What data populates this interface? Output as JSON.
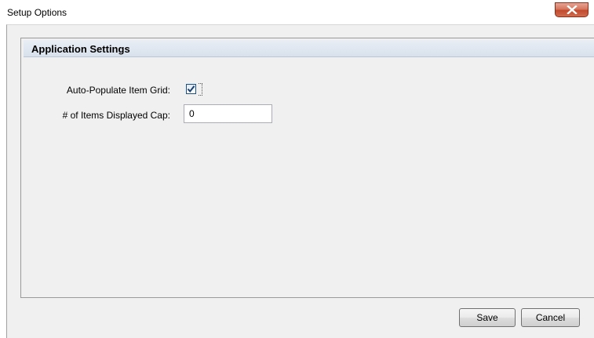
{
  "window": {
    "title": "Setup Options",
    "close_icon": "close-x-icon"
  },
  "group": {
    "title": "Application Settings"
  },
  "settings": {
    "auto_populate_label": "Auto-Populate Item Grid:",
    "auto_populate_checked": true,
    "items_cap_label": "# of Items Displayed Cap:",
    "items_cap_value": "0"
  },
  "buttons": {
    "save_label": "Save",
    "cancel_label": "Cancel"
  },
  "colors": {
    "close_button": "#c24a2c",
    "group_header": "#d8e1ec",
    "checkbox_border": "#1c5180",
    "checkmark": "#1c3f6e"
  }
}
